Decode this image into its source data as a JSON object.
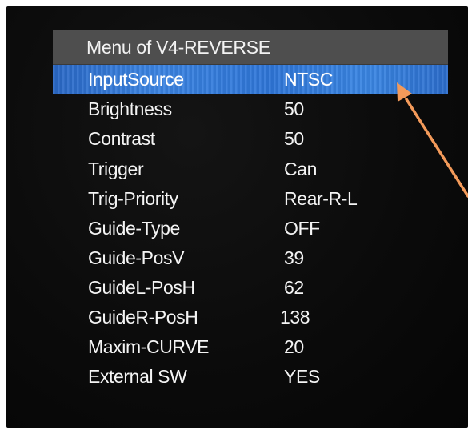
{
  "menu": {
    "title": "Menu of V4-REVERSE",
    "selected_index": 0,
    "items": [
      {
        "label": "InputSource",
        "value": "NTSC"
      },
      {
        "label": "Brightness",
        "value": "50"
      },
      {
        "label": "Contrast",
        "value": "50"
      },
      {
        "label": "Trigger",
        "value": "Can"
      },
      {
        "label": "Trig-Priority",
        "value": "Rear-R-L"
      },
      {
        "label": "Guide-Type",
        "value": "OFF"
      },
      {
        "label": "Guide-PosV",
        "value": "39"
      },
      {
        "label": "GuideL-PosH",
        "value": "62"
      },
      {
        "label": "GuideR-PosH",
        "value": "138"
      },
      {
        "label": "Maxim-CURVE",
        "value": "20"
      },
      {
        "label": "External SW",
        "value": "YES"
      }
    ]
  },
  "colors": {
    "highlight": "#3b84e2",
    "header": "#4e4e4e",
    "background": "#0b0b0b",
    "arrow": "#f39a5a"
  },
  "icons": {
    "pointer_arrow": "arrow-icon"
  }
}
